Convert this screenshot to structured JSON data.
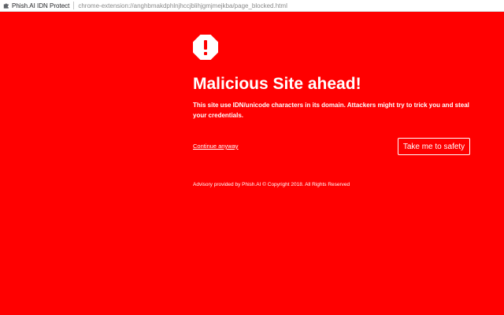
{
  "window": {
    "extension_name": "Phish.AI IDN Protect",
    "url": "chrome-extension://anghbmakdphlnjhccjblihjgmjmejkba/page_blocked.html",
    "icon": "puzzle-icon"
  },
  "page": {
    "background_color": "#ff0000",
    "text_color": "#ffffff",
    "icon": "warning-octagon-icon",
    "title": "Malicious Site ahead!",
    "description": "This site use IDN/unicode characters in its domain. Attackers might try to trick you and steal your credentials.",
    "continue_link": "Continue anyway",
    "safety_button": "Take me to safety",
    "footer": "Advisory provided by Phish.AI © Copyright 2018. All Rights Reserved"
  }
}
